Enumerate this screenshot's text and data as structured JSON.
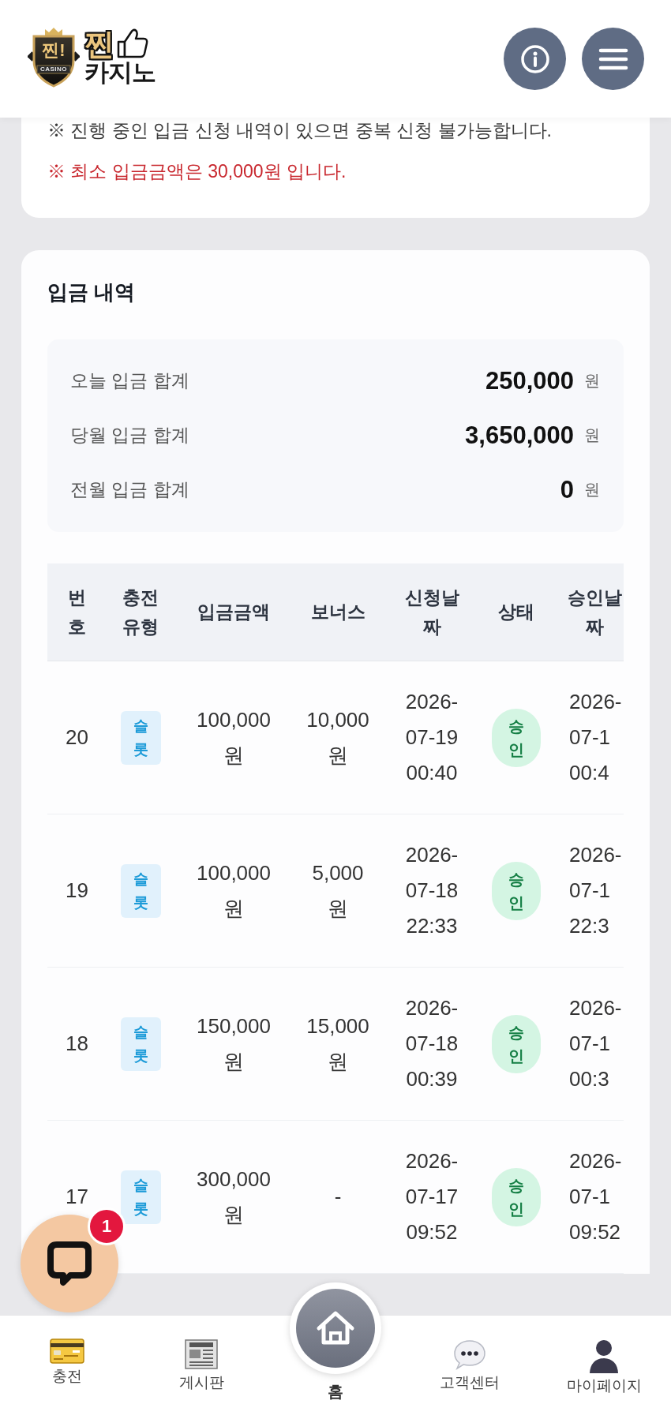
{
  "header": {
    "logo": {
      "emblem_text": "찐!",
      "emblem_caption": "CASINO",
      "wordmark_top": "찐",
      "wordmark_bottom": "카지노"
    }
  },
  "notices": [
    {
      "text": "※ 진행 중인 입금 신청 내역이 있으면 중복 신청 불가능합니다.",
      "kind": "normal"
    },
    {
      "text": "※ 최소 입금금액은 30,000원 입니다.",
      "kind": "warning"
    }
  ],
  "deposit_history": {
    "title": "입금 내역",
    "summary": [
      {
        "label": "오늘 입금 합계",
        "value": "250,000",
        "unit": "원"
      },
      {
        "label": "당월 입금 합계",
        "value": "3,650,000",
        "unit": "원"
      },
      {
        "label": "전월 입금 합계",
        "value": "0",
        "unit": "원"
      }
    ],
    "table": {
      "columns": [
        "번호",
        "충전유형",
        "입금금액",
        "보너스",
        "신청날짜",
        "상태",
        "승인날짜"
      ],
      "rows": [
        {
          "no": "20",
          "type": "슬롯",
          "amount": "100,000원",
          "bonus": "10,000원",
          "requested": "2026-07-19 00:40",
          "status": "승인",
          "approved": "2026-07-1 00:4"
        },
        {
          "no": "19",
          "type": "슬롯",
          "amount": "100,000원",
          "bonus": "5,000원",
          "requested": "2026-07-18 22:33",
          "status": "승인",
          "approved": "2026-07-1 22:3"
        },
        {
          "no": "18",
          "type": "슬롯",
          "amount": "150,000원",
          "bonus": "15,000원",
          "requested": "2026-07-18 00:39",
          "status": "승인",
          "approved": "2026-07-1 00:3"
        },
        {
          "no": "17",
          "type": "슬롯",
          "amount": "300,000원",
          "bonus": "-",
          "requested": "2026-07-17 09:52",
          "status": "승인",
          "approved": "2026-07-1 09:52"
        }
      ]
    }
  },
  "chat_button": {
    "badge": "1"
  },
  "bottom_nav": [
    {
      "label": "충전",
      "kind": "item"
    },
    {
      "label": "게시판",
      "kind": "item"
    },
    {
      "label": "홈",
      "kind": "center"
    },
    {
      "label": "고객센터",
      "kind": "item"
    },
    {
      "label": "마이페이지",
      "kind": "item"
    }
  ]
}
